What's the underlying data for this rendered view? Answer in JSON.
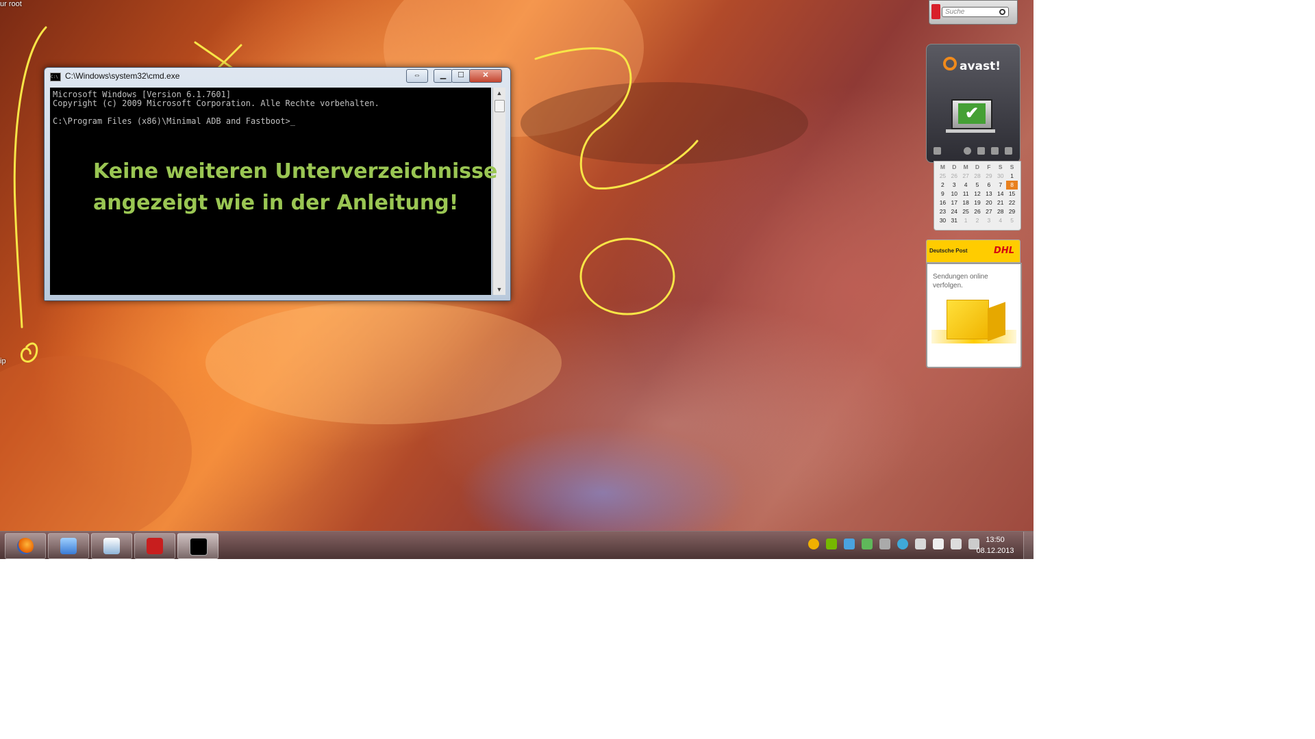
{
  "desktop": {
    "top_label": "ur root",
    "side_label": "ip"
  },
  "cmd_window": {
    "title": "C:\\Windows\\system32\\cmd.exe",
    "icon_text": "C:\\",
    "console_lines": [
      "Microsoft Windows [Version 6.1.7601]",
      "Copyright (c) 2009 Microsoft Corporation. Alle Rechte vorbehalten.",
      "",
      "C:\\Program Files (x86)\\Minimal ADB and Fastboot>_"
    ],
    "buttons": {
      "resize": "⇔",
      "minimize": "▁",
      "maximize": "☐",
      "close": "✕"
    }
  },
  "annotation": {
    "line1": "Keine weiteren Unterverzeichnisse",
    "line2": "angezeigt wie in der Anleitung!",
    "color": "#9ac653",
    "marker_color": "#f7e547"
  },
  "taskbar": {
    "buttons": [
      {
        "name": "firefox",
        "icon": "firefox-icon",
        "color": "#e66000"
      },
      {
        "name": "network",
        "icon": "network-icon",
        "color": "#3a7bd5"
      },
      {
        "name": "mail",
        "icon": "mail-icon",
        "color": "#8fb4d8"
      },
      {
        "name": "acrobat",
        "icon": "pdf-icon",
        "color": "#c81e1e"
      },
      {
        "name": "cmd",
        "icon": "cmd-icon",
        "color": "#000000"
      }
    ],
    "clock": {
      "time": "13:50",
      "date": "08.12.2013"
    }
  },
  "gadgets": {
    "search": {
      "placeholder": "Suche"
    },
    "avast": {
      "name": "avast!"
    },
    "calendar": {
      "weekday_headers": [
        "M",
        "D",
        "M",
        "D",
        "F",
        "S",
        "S"
      ],
      "rows": [
        [
          "25",
          "26",
          "27",
          "28",
          "29",
          "30",
          "1"
        ],
        [
          "2",
          "3",
          "4",
          "5",
          "6",
          "7",
          "8"
        ],
        [
          "9",
          "10",
          "11",
          "12",
          "13",
          "14",
          "15"
        ],
        [
          "16",
          "17",
          "18",
          "19",
          "20",
          "21",
          "22"
        ],
        [
          "23",
          "24",
          "25",
          "26",
          "27",
          "28",
          "29"
        ],
        [
          "30",
          "31",
          "1",
          "2",
          "3",
          "4",
          "5"
        ]
      ],
      "today": "8"
    },
    "dhl": {
      "brand_left": "Deutsche Post",
      "brand_right": "DHL",
      "text": "Sendungen online verfolgen."
    }
  }
}
